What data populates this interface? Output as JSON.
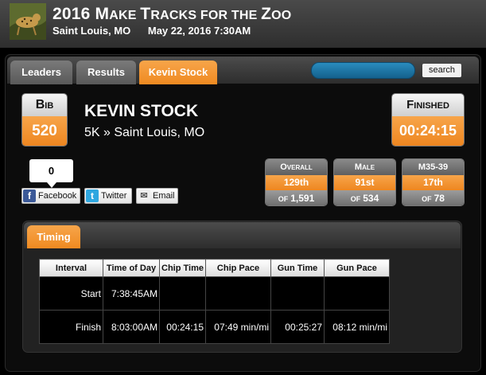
{
  "event": {
    "title_first": "2016 M",
    "title_rest_a": "AKE ",
    "title_t": "T",
    "title_rest_b": "RACKS FOR THE ",
    "title_z": "Z",
    "title_rest_c": "OO",
    "location": "Saint Louis, MO",
    "datetime": "May 22, 2016 7:30AM"
  },
  "tabs": [
    {
      "label": "Leaders",
      "active": false
    },
    {
      "label": "Results",
      "active": false
    },
    {
      "label": "Kevin Stock",
      "active": true
    }
  ],
  "search": {
    "placeholder": "",
    "button_label": "search"
  },
  "bib": {
    "label": "Bib",
    "number": "520"
  },
  "runner": {
    "name": "KEVIN STOCK",
    "race": "5K » Saint Louis, MO"
  },
  "finished": {
    "label": "Finished",
    "time": "00:24:15"
  },
  "share": {
    "count": "0",
    "facebook": "Facebook",
    "twitter": "Twitter",
    "email": "Email"
  },
  "ranks": [
    {
      "label": "Overall",
      "place": "129th",
      "of_label": "OF",
      "total": "1,591"
    },
    {
      "label": "Male",
      "place": "91st",
      "of_label": "OF",
      "total": "534"
    },
    {
      "label": "M35-39",
      "place": "17th",
      "of_label": "OF",
      "total": "78"
    }
  ],
  "timing": {
    "tab_label": "Timing",
    "columns": [
      "Interval",
      "Time of Day",
      "Chip Time",
      "Chip Pace",
      "Gun Time",
      "Gun Pace"
    ],
    "rows": [
      [
        "Start",
        "7:38:45AM",
        "",
        "",
        "",
        ""
      ],
      [
        "Finish",
        "8:03:00AM",
        "00:24:15",
        "07:49 min/mi",
        "00:25:27",
        "08:12 min/mi"
      ]
    ]
  },
  "colors": {
    "accent": "#ef8a21",
    "search_field": "#1e76a6",
    "background": "#000000"
  },
  "icons": [
    "event-thumbnail",
    "facebook-icon",
    "twitter-icon",
    "email-icon"
  ]
}
